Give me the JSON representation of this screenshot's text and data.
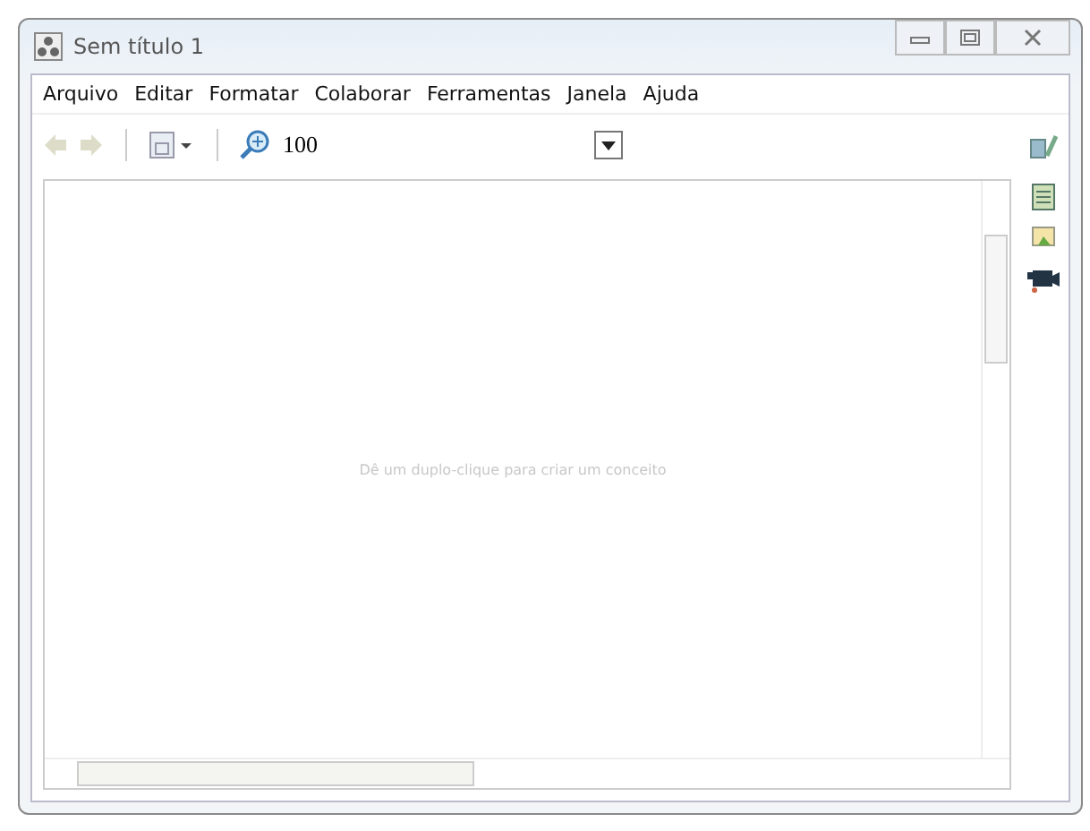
{
  "window": {
    "title": "Sem título 1"
  },
  "menu": [
    "Arquivo",
    "Editar",
    "Formatar",
    "Colaborar",
    "Ferramentas",
    "Janela",
    "Ajuda"
  ],
  "toolbar": {
    "zoom": "100"
  },
  "canvas": {
    "hint": "Dê um duplo-clique para criar um conceito"
  }
}
